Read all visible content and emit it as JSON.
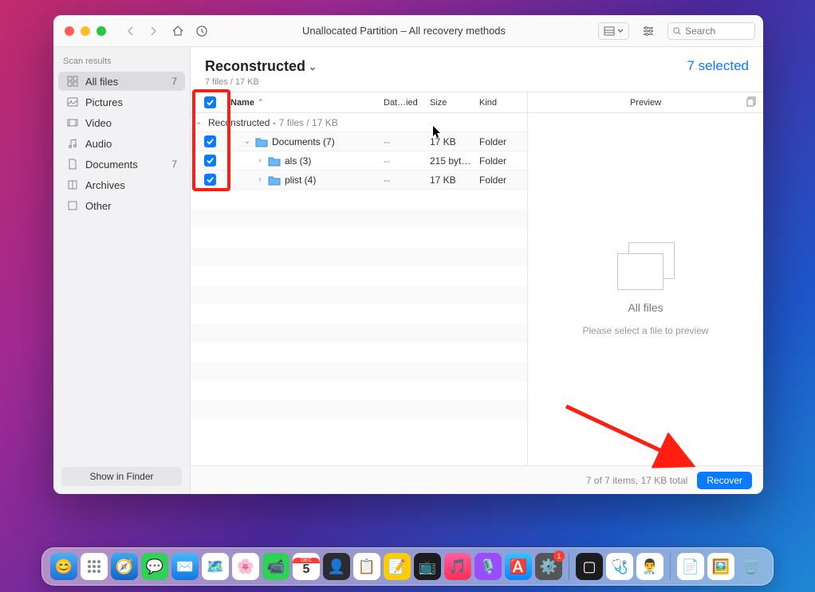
{
  "window_title": "Unallocated Partition – All recovery methods",
  "search_placeholder": "Search",
  "selected_label": "7 selected",
  "sidebar": {
    "header": "Scan results",
    "items": [
      {
        "label": "All files",
        "count": "7",
        "active": true,
        "icon": "grid"
      },
      {
        "label": "Pictures",
        "icon": "image"
      },
      {
        "label": "Video",
        "icon": "video"
      },
      {
        "label": "Audio",
        "icon": "audio"
      },
      {
        "label": "Documents",
        "count": "7",
        "icon": "doc"
      },
      {
        "label": "Archives",
        "icon": "archive"
      },
      {
        "label": "Other",
        "icon": "other"
      }
    ],
    "show_in_finder": "Show in Finder"
  },
  "main": {
    "title": "Reconstructed",
    "subtitle": "7 files / 17 KB"
  },
  "columns": {
    "name": "Name",
    "date": "Dat…ied",
    "size": "Size",
    "kind": "Kind"
  },
  "group": {
    "label": "Reconstructed -",
    "meta": "7 files / 17 KB"
  },
  "rows": [
    {
      "name": "Documents (7)",
      "date": "--",
      "size": "17 KB",
      "kind": "Folder",
      "expand": "down",
      "indent": 1
    },
    {
      "name": "als (3)",
      "date": "--",
      "size": "215 byt…",
      "kind": "Folder",
      "expand": "right",
      "indent": 2
    },
    {
      "name": "plist (4)",
      "date": "--",
      "size": "17 KB",
      "kind": "Folder",
      "expand": "right",
      "indent": 2
    }
  ],
  "preview": {
    "header": "Preview",
    "title": "All files",
    "sub": "Please select a file to preview"
  },
  "footer": {
    "summary": "7 of 7 items, 17 KB total",
    "recover": "Recover"
  }
}
